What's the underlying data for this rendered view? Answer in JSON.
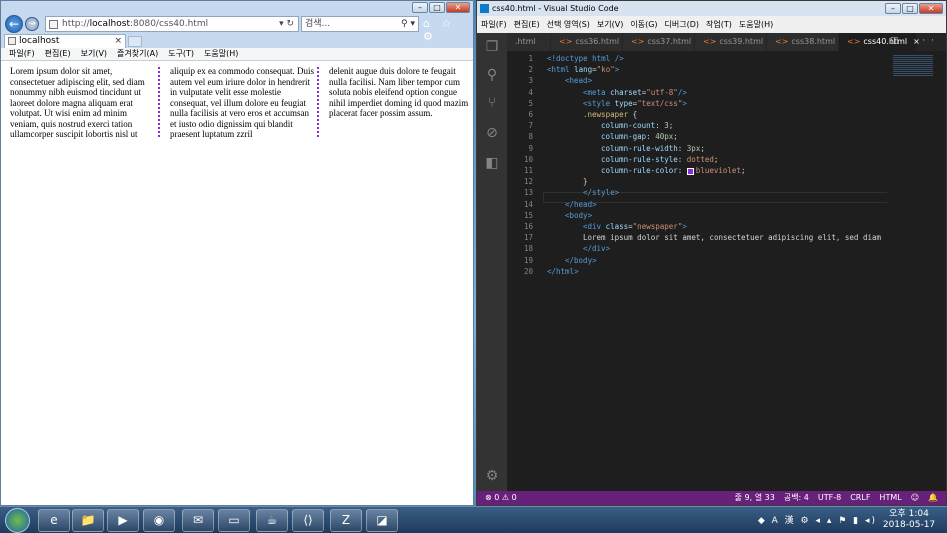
{
  "ie": {
    "address": {
      "prefix": "http://",
      "host": "localhost",
      "rest": ":8080/css40.html",
      "icons": "▾ ↻"
    },
    "search_placeholder": "검색...",
    "search_icon": "⚲ ▾",
    "tools_icons": "⌂ ☆ ⚙",
    "tab_label": "localhost",
    "menu": [
      "파일(F)",
      "편집(E)",
      "보기(V)",
      "즐겨찾기(A)",
      "도구(T)",
      "도움말(H)"
    ],
    "columns": [
      "Lorem ipsum dolor sit amet, consectetuer adipiscing elit, sed diam nonummy nibh euismod tincidunt ut laoreet dolore magna aliquam erat volutpat. Ut wisi enim ad minim veniam, quis nostrud exerci tation ullamcorper suscipit lobortis nisl ut",
      "aliquip ex ea commodo consequat. Duis autem vel eum iriure dolor in hendrerit in vulputate velit esse molestie consequat, vel illum dolore eu feugiat nulla facilisis at vero eros et accumsan et iusto odio dignissim qui blandit praesent luptatum zzril",
      "delenit augue duis dolore te feugait nulla facilisi. Nam liber tempor cum soluta nobis eleifend option congue nihil imperdiet doming id quod mazim placerat facer possim assum."
    ],
    "rule_color": "#8a2be2"
  },
  "vscode": {
    "title": "css40.html - Visual Studio Code",
    "menu": [
      "파일(F)",
      "편집(E)",
      "선택 영역(S)",
      "보기(V)",
      "이동(G)",
      "디버그(D)",
      "작업(T)",
      "도움말(H)"
    ],
    "tabs": [
      {
        "label": ".html",
        "active": false
      },
      {
        "label": "css36.html",
        "active": false
      },
      {
        "label": "css37.html",
        "active": false
      },
      {
        "label": "css39.html",
        "active": false
      },
      {
        "label": "css38.html",
        "active": false
      },
      {
        "label": "css40.html",
        "active": true
      }
    ],
    "tab_icons": "◫ ···",
    "line_numbers": [
      "1",
      "2",
      "3",
      "4",
      "5",
      "6",
      "7",
      "8",
      "9",
      "10",
      "11",
      "12",
      "13",
      "14",
      "15",
      "16",
      "17",
      "18",
      "19",
      "20"
    ],
    "code": {
      "l1": "<!doctype html />",
      "l2a": "<html",
      "l2b": " lang",
      "l2c": "=",
      "l2d": "\"ko\"",
      "l2e": ">",
      "l3": "<head>",
      "l4a": "<meta",
      "l4b": " charset",
      "l4c": "=",
      "l4d": "\"utf-8\"",
      "l4e": "/>",
      "l5a": "<style",
      "l5b": " type",
      "l5c": "=",
      "l5d": "\"text/css\"",
      "l5e": ">",
      "l6a": ".newspaper",
      "l6b": " {",
      "l7a": "column-count",
      "l7b": ": ",
      "l7c": "3",
      "l7d": ";",
      "l8a": "column-gap",
      "l8b": ": ",
      "l8c": "40px",
      "l8d": ";",
      "l9a": "column-rule-width",
      "l9b": ": ",
      "l9c": "3px",
      "l9d": ";",
      "l10a": "column-rule-style",
      "l10b": ": ",
      "l10c": "dotted",
      "l10d": ";",
      "l11a": "column-rule-color",
      "l11b": ": ",
      "l11c": "blueviolet",
      "l11d": ";",
      "l12": "}",
      "l13": "</style>",
      "l14": "</head>",
      "l15": "<body>",
      "l16a": "<div",
      "l16b": " class",
      "l16c": "=",
      "l16d": "\"newspaper\"",
      "l16e": ">",
      "l17": "Lorem ipsum dolor sit amet, consectetuer adipiscing elit, sed diam",
      "l18": "</div>",
      "l19": "</body>",
      "l20": "</html>"
    },
    "status": {
      "problems": "⊗ 0 ⚠ 0",
      "position": "줄 9, 열 33",
      "spaces": "공백: 4",
      "encoding": "UTF-8",
      "eol": "CRLF",
      "language": "HTML",
      "feedback_icon": "☺",
      "bell_icon": "🔔"
    }
  },
  "taskbar": {
    "apps": [
      "e",
      "📁",
      "▶",
      "◉",
      "✉",
      "▭",
      "☕",
      "⟨⟩",
      "Z",
      "◪"
    ],
    "tray_icons": "◆ A 漢 ⚙ ◂ ▴ ⚑ ▮ ◂)",
    "time": "오후 1:04",
    "date": "2018-05-17"
  }
}
